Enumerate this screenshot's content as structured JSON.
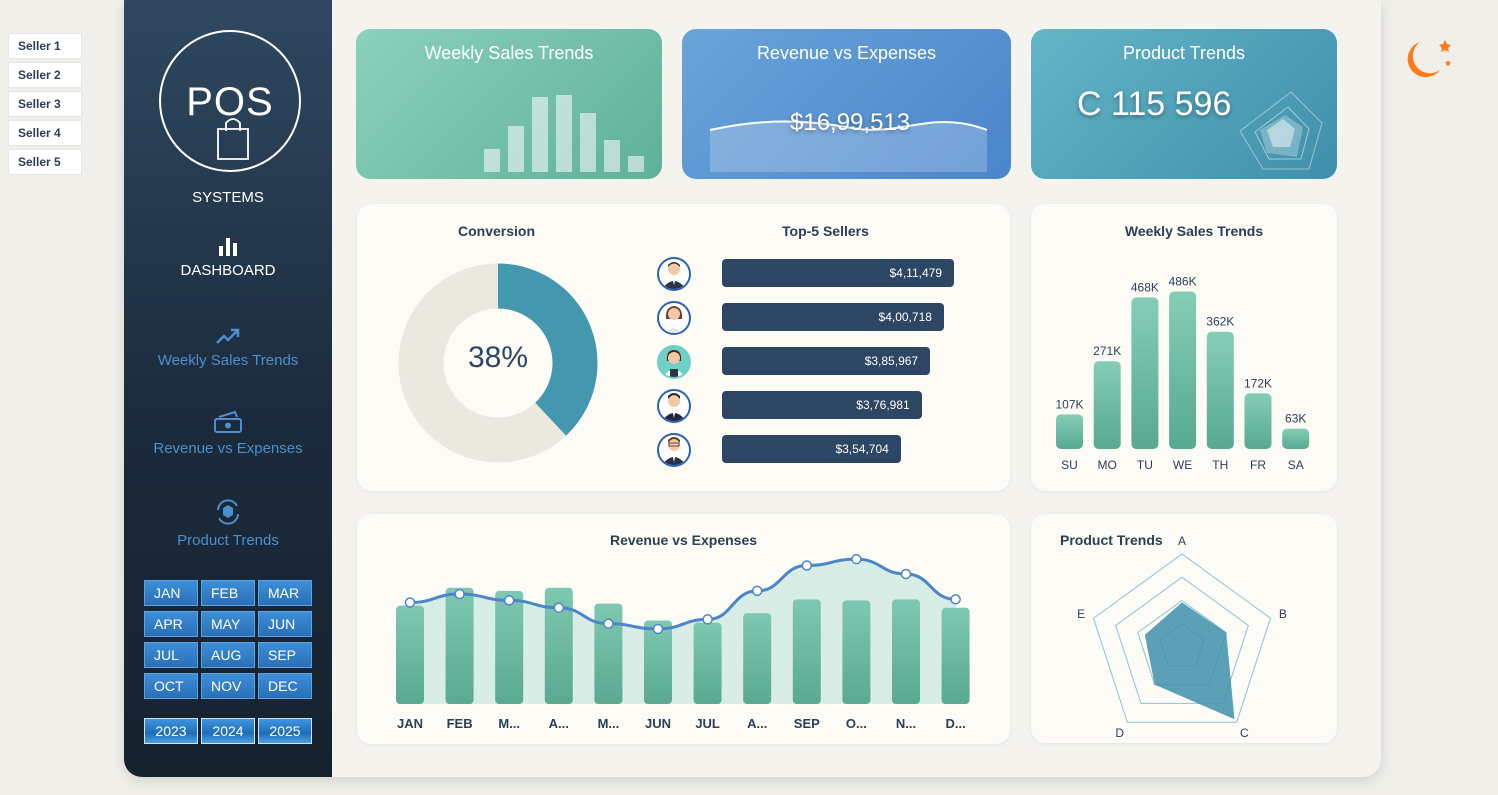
{
  "sellers": [
    "Seller 1",
    "Seller 2",
    "Seller 3",
    "Seller 4",
    "Seller 5"
  ],
  "sidebar": {
    "logo_text": "POS",
    "logo_sub": "SYSTEMS",
    "nav": {
      "dashboard": "DASHBOARD",
      "weekly": "Weekly Sales Trends",
      "revenue": "Revenue vs Expenses",
      "product": "Product Trends"
    },
    "months": [
      "JAN",
      "FEB",
      "MAR",
      "APR",
      "MAY",
      "JUN",
      "JUL",
      "AUG",
      "SEP",
      "OCT",
      "NOV",
      "DEC"
    ],
    "years": [
      "2023",
      "2024",
      "2025"
    ]
  },
  "kpis": {
    "weekly_title": "Weekly Sales Trends",
    "revenue_title": "Revenue vs Expenses",
    "revenue_value": "$16,99,513",
    "product_title": "Product Trends",
    "product_value": "C  115 596"
  },
  "conversion": {
    "title": "Conversion",
    "value_label": "38%",
    "fraction": 0.38,
    "colors": {
      "filled": "#4498ae",
      "rest": "#ebe8df"
    }
  },
  "top_sellers": {
    "title": "Top-5 Sellers",
    "rows": [
      {
        "label": "$4,11,479",
        "value": 411479
      },
      {
        "label": "$4,00,718",
        "value": 400718
      },
      {
        "label": "$3,85,967",
        "value": 385967
      },
      {
        "label": "$3,76,981",
        "value": 376981
      },
      {
        "label": "$3,54,704",
        "value": 354704
      }
    ]
  },
  "chart_data": [
    {
      "type": "bar",
      "title": "Weekly Sales Trends",
      "categories": [
        "SU",
        "MO",
        "TU",
        "WE",
        "TH",
        "FR",
        "SA"
      ],
      "values": [
        107,
        271,
        468,
        486,
        362,
        172,
        63
      ],
      "value_labels": [
        "107K",
        "271K",
        "468K",
        "486K",
        "362K",
        "172K",
        "63K"
      ],
      "ylim": [
        0,
        500
      ],
      "color": "#66b8a0"
    },
    {
      "type": "bar",
      "title": "Revenue vs Expenses",
      "categories": [
        "JAN",
        "FEB",
        "M...",
        "A...",
        "M...",
        "JUN",
        "JUL",
        "A...",
        "SEP",
        "O...",
        "N...",
        "D..."
      ],
      "series": [
        {
          "kind": "bar",
          "values": [
            93,
            110,
            107,
            110,
            95,
            79,
            77,
            86,
            99,
            98,
            99,
            91
          ]
        },
        {
          "kind": "line",
          "values": [
            96,
            104,
            98,
            91,
            76,
            71,
            80,
            107,
            131,
            137,
            123,
            99
          ]
        }
      ],
      "ylim": [
        0,
        140
      ],
      "colors": {
        "bar": "#66b8a0",
        "line": "#4a86c8",
        "area": "#d8ede6"
      }
    },
    {
      "type": "radar",
      "title": "Product Trends",
      "axes": [
        "A",
        "B",
        "C",
        "D",
        "E"
      ],
      "values": [
        0.48,
        0.5,
        0.96,
        0.5,
        0.42
      ],
      "rings": 4,
      "colors": {
        "fill": "#3f8fab",
        "grid": "#8bc3d3"
      }
    }
  ]
}
